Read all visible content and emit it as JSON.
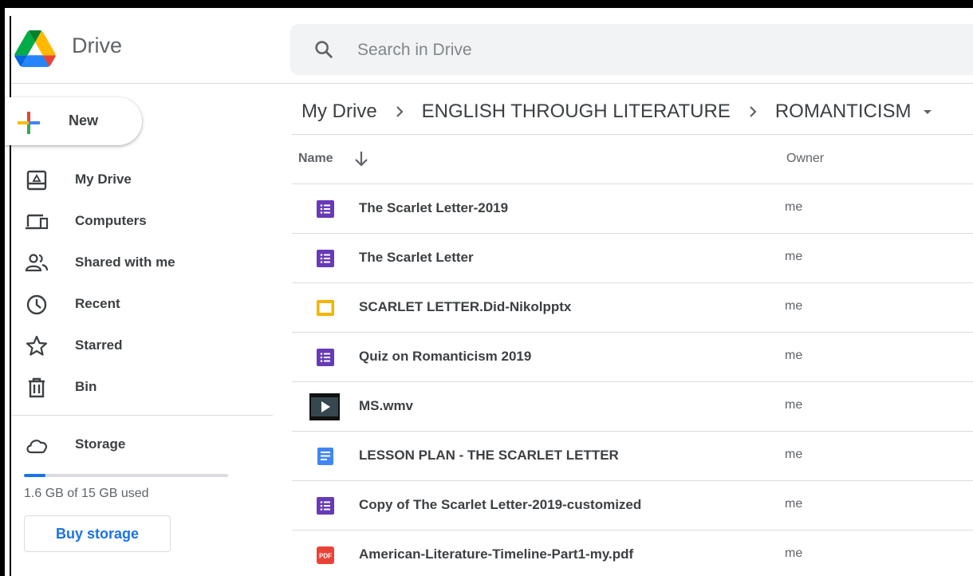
{
  "app": {
    "brand": "Drive",
    "colors": {
      "blue": "#4285F4",
      "green": "#34A853",
      "yellow": "#FBBC04",
      "red": "#EA4335",
      "accent": "#1a73e8"
    }
  },
  "search": {
    "placeholder": "Search in Drive",
    "value": "",
    "icon": "search-icon"
  },
  "sidebar": {
    "new_label": "New",
    "items": [
      {
        "label": "My Drive",
        "icon": "my-drive-icon"
      },
      {
        "label": "Computers",
        "icon": "computers-icon"
      },
      {
        "label": "Shared with me",
        "icon": "shared-people-icon"
      },
      {
        "label": "Recent",
        "icon": "clock-icon"
      },
      {
        "label": "Starred",
        "icon": "star-icon"
      },
      {
        "label": "Bin",
        "icon": "trash-icon"
      }
    ],
    "storage": {
      "label": "Storage",
      "icon": "cloud-icon",
      "used_text": "1.6 GB of 15 GB used",
      "used_fraction": 0.107,
      "buy_label": "Buy storage"
    }
  },
  "breadcrumb": {
    "items": [
      "My Drive",
      "ENGLISH THROUGH LITERATURE",
      "ROMANTICISM"
    ]
  },
  "list": {
    "columns": {
      "name": "Name",
      "owner": "Owner"
    },
    "sort_icon": "arrow-down-icon",
    "files": [
      {
        "name": "The Scarlet Letter-2019",
        "owner": "me",
        "type": "forms",
        "color": "#673AB7"
      },
      {
        "name": "The Scarlet Letter",
        "owner": "me",
        "type": "forms",
        "color": "#673AB7"
      },
      {
        "name": "SCARLET LETTER.Did-Nikolpptx",
        "owner": "me",
        "type": "slides",
        "color": "#F4B400"
      },
      {
        "name": "Quiz on Romanticism 2019",
        "owner": "me",
        "type": "forms",
        "color": "#673AB7"
      },
      {
        "name": "MS.wmv",
        "owner": "me",
        "type": "video",
        "color": "#37474F"
      },
      {
        "name": "LESSON PLAN - THE SCARLET LETTER",
        "owner": "me",
        "type": "docs",
        "color": "#4285F4"
      },
      {
        "name": "Copy of The Scarlet Letter-2019-customized",
        "owner": "me",
        "type": "forms",
        "color": "#673AB7"
      },
      {
        "name": "American-Literature-Timeline-Part1-my.pdf",
        "owner": "me",
        "type": "pdf",
        "color": "#EA4335",
        "badge": "PDF"
      }
    ]
  }
}
